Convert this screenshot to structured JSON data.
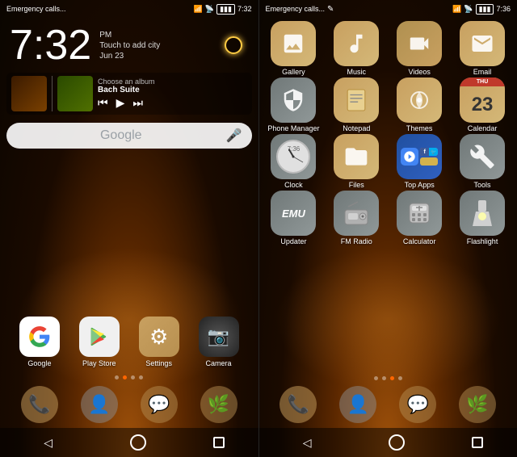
{
  "left": {
    "statusBar": {
      "left": "Emergency calls...",
      "time": "7:32",
      "signal": true,
      "wifi": true,
      "battery": true
    },
    "clock": {
      "time": "7:32",
      "ampm": "PM",
      "addCity": "Touch to add city",
      "date": "Jun 23"
    },
    "music": {
      "title": "Bach Suite",
      "chooseAlbum": "Choose an album"
    },
    "googleSearch": {
      "placeholder": "Google"
    },
    "apps": [
      {
        "label": "Google",
        "iconClass": "icon-google",
        "icon": "G"
      },
      {
        "label": "Play Store",
        "iconClass": "icon-playstore",
        "icon": "▶"
      },
      {
        "label": "Settings",
        "iconClass": "icon-settings",
        "icon": "⚙"
      },
      {
        "label": "Camera",
        "iconClass": "icon-camera",
        "icon": "📷"
      }
    ],
    "dots": [
      false,
      true,
      false,
      false
    ],
    "dock": [
      "📞",
      "👤",
      "💬",
      "🌿"
    ],
    "navBar": {
      "back": "◁",
      "home": "○",
      "recents": "□"
    }
  },
  "right": {
    "statusBar": {
      "left": "Emergency calls...",
      "editIcon": "✎",
      "time": "7:36"
    },
    "appGrid": [
      [
        {
          "label": "Gallery",
          "iconClass": "icon-gallery",
          "icon": "🖼"
        },
        {
          "label": "Music",
          "iconClass": "icon-music",
          "icon": "🎵"
        },
        {
          "label": "Videos",
          "iconClass": "icon-videos",
          "icon": "▶"
        },
        {
          "label": "Email",
          "iconClass": "icon-email",
          "icon": "✉"
        }
      ],
      [
        {
          "label": "Phone Manager",
          "iconClass": "icon-phonemanager",
          "icon": "🛡"
        },
        {
          "label": "Notepad",
          "iconClass": "icon-notepad",
          "icon": "📝"
        },
        {
          "label": "Themes",
          "iconClass": "icon-themes",
          "icon": "✿"
        },
        {
          "label": "Calendar",
          "iconClass": "icon-calendar",
          "icon": "cal"
        }
      ],
      [
        {
          "label": "Clock",
          "iconClass": "icon-clock",
          "icon": "clk"
        },
        {
          "label": "Files",
          "iconClass": "icon-files",
          "icon": "📁"
        },
        {
          "label": "Top Apps",
          "iconClass": "icon-topapps",
          "icon": "apps"
        },
        {
          "label": "Tools",
          "iconClass": "icon-tools",
          "icon": "⚙"
        }
      ],
      [
        {
          "label": "Updater",
          "iconClass": "icon-updater",
          "icon": "EMU"
        },
        {
          "label": "FM Radio",
          "iconClass": "icon-fmradio",
          "icon": "📻"
        },
        {
          "label": "Calculator",
          "iconClass": "icon-calculator",
          "icon": "+-"
        },
        {
          "label": "Flashlight",
          "iconClass": "icon-flashlight",
          "icon": "🔦"
        }
      ]
    ],
    "dots": [
      false,
      false,
      true,
      false
    ],
    "dock": [
      "📞",
      "👤",
      "💬",
      "🌿"
    ],
    "navBar": {
      "back": "◁",
      "home": "○",
      "recents": "□"
    }
  }
}
